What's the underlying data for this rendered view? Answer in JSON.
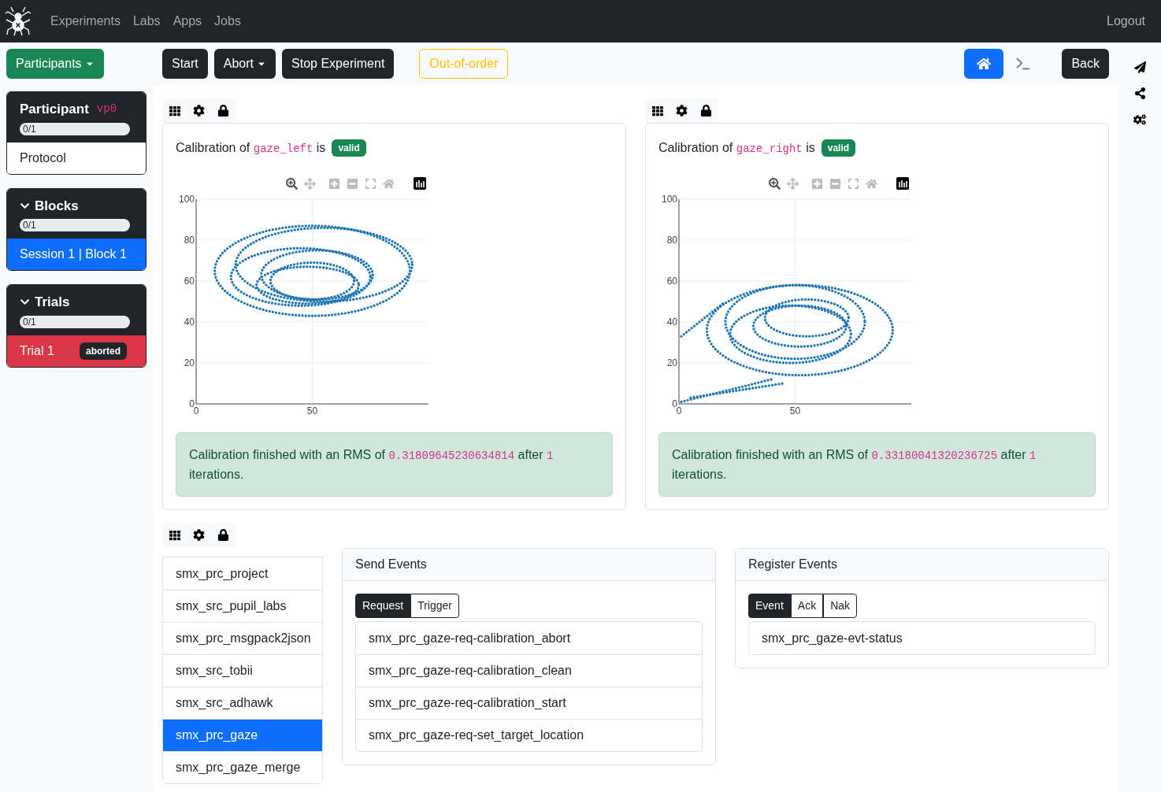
{
  "navbar": {
    "links": [
      "Experiments",
      "Labs",
      "Apps",
      "Jobs"
    ],
    "logout": "Logout"
  },
  "toolbar": {
    "participants_button": "Participants",
    "buttons": [
      {
        "label": "Start",
        "kind": "plain"
      },
      {
        "label": "Abort",
        "kind": "dropdown"
      },
      {
        "label": "Stop Experiment",
        "kind": "plain"
      }
    ],
    "status_button": "Out-of-order",
    "back_button": "Back"
  },
  "sidebar": [
    {
      "title": "Participant",
      "code": "vp0",
      "progress": "0/1",
      "level": 0,
      "items": [
        {
          "label": "Protocol",
          "selected": false
        }
      ]
    },
    {
      "title": "Blocks",
      "expanded": true,
      "progress": "0/1",
      "level": 0,
      "items": [
        {
          "label": "Session 1 | Block 1",
          "selected": true
        }
      ]
    },
    {
      "title": "Trials",
      "expanded": true,
      "progress": "0/1",
      "level": 0,
      "items": [
        {
          "label": "Trial 1",
          "badge": "aborted",
          "color": "#dc3545"
        }
      ]
    }
  ],
  "calibrations": [
    {
      "prefix": "Calibration of",
      "name": "gaze_left",
      "suffix": "is",
      "badge": "valid",
      "valid": true,
      "message_start": "Calibration finished with an RMS of",
      "rms": "0.31809645230634814",
      "message_mid": "after",
      "iterations": "1",
      "message_end": "iterations.",
      "chart_data": {
        "type": "scatter",
        "grid": true,
        "xlim": [
          0,
          100
        ],
        "ylim": [
          0,
          100
        ],
        "xticks": [
          {
            "value": 0,
            "label": "0"
          },
          50
        ],
        "yticks": [
          {
            "value": 0,
            "label": "0"
          },
          20,
          40,
          60,
          80,
          100
        ]
      }
    },
    {
      "prefix": "Calibration of",
      "name": "gaze_right",
      "suffix": "is",
      "badge": "valid",
      "valid": true,
      "message_start": "Calibration finished with an RMS of",
      "rms": "0.33180041320236725",
      "message_mid": "after",
      "iterations": "1",
      "message_end": "iterations.",
      "chart_data": {
        "type": "scatter",
        "grid": true,
        "xlim": [
          0,
          100
        ],
        "ylim": [
          0,
          100
        ],
        "xticks": [
          {
            "value": 0,
            "label": "0"
          },
          50
        ],
        "yticks": [
          {
            "value": 0,
            "label": "0"
          },
          20,
          40,
          60,
          80,
          100
        ]
      }
    }
  ],
  "modules": [
    {
      "label": "smx_prc_project",
      "selected": false
    },
    {
      "label": "smx_src_pupil_labs",
      "selected": false
    },
    {
      "label": "smx_prc_msgpack2json",
      "selected": false
    },
    {
      "label": "smx_src_tobii",
      "selected": false
    },
    {
      "label": "smx_src_adhawk",
      "selected": false
    },
    {
      "label": "smx_prc_gaze",
      "selected": true
    },
    {
      "label": "smx_prc_gaze_merge",
      "selected": false
    }
  ],
  "send_events": {
    "title": "Send Events",
    "tabs": [
      {
        "label": "Request",
        "selected": true
      },
      {
        "label": "Trigger",
        "selected": false
      }
    ],
    "items": [
      "smx_prc_gaze-req-calibration_abort",
      "smx_prc_gaze-req-calibration_clean",
      "smx_prc_gaze-req-calibration_start",
      "smx_prc_gaze-req-set_target_location"
    ]
  },
  "register_events": {
    "title": "Register Events",
    "tabs": [
      {
        "label": "Event",
        "selected": true
      },
      {
        "label": "Ack",
        "selected": false
      },
      {
        "label": "Nak",
        "selected": false
      }
    ],
    "items": [
      "smx_prc_gaze-evt-status"
    ]
  }
}
